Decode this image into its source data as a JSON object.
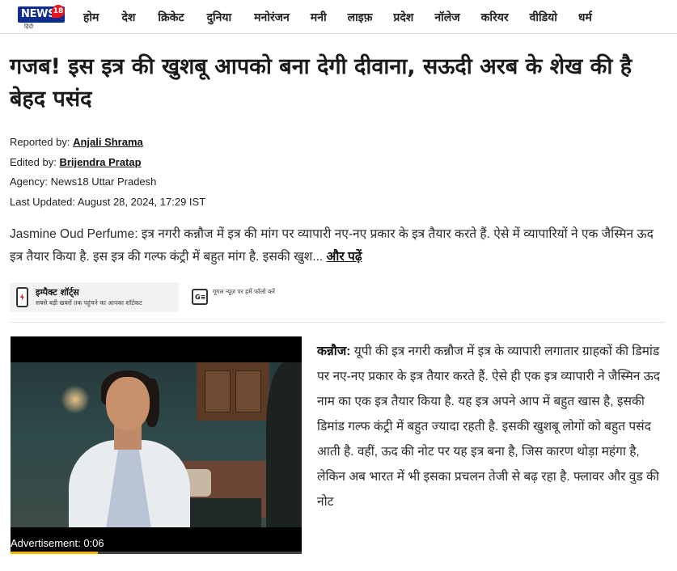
{
  "logo": {
    "brand": "NEWS",
    "number": "18",
    "sub": "हिंदी"
  },
  "nav": {
    "items": [
      "होम",
      "देश",
      "क्रिकेट",
      "दुनिया",
      "मनोरंजन",
      "मनी",
      "लाइफ़",
      "प्रदेश",
      "नॉलेज",
      "करियर",
      "वीडियो",
      "धर्म"
    ]
  },
  "headline": "गजब! इस इत्र की खुशबू आपको बना देगी दीवाना, सऊदी अरब के शेख की है बेहद पसंद",
  "meta": {
    "reported_label": "Reported by:",
    "reported_value": "Anjali Shrama",
    "edited_label": "Edited by:",
    "edited_value": "Brijendra Pratap",
    "agency_label": "Agency:",
    "agency_value": "News18 Uttar Pradesh",
    "updated_label": "Last Updated:",
    "updated_value": "August 28, 2024, 17:29 IST"
  },
  "summary": {
    "text": "Jasmine Oud Perfume: इत्र नगरी कन्नौज में इत्र की मांग पर व्यापारी नए-नए प्रकार के इत्र तैयार करते हैं. ऐसे में व्यापारियों ने एक जैस्मिन ऊद इत्र तैयार किया है. इस इत्र की गल्फ कंट्री में बहुत मांग है. इसकी खुश...",
    "read_more": "और पढ़ें"
  },
  "impact": {
    "title": "इम्पैक्ट शॉर्ट्स",
    "subtitle": "सबसे बड़ी खबरों तक पहुंचने का आपका शॉर्टकट"
  },
  "google_news": {
    "text": "गूगल न्यूज़ पर हमें फॉलो करें"
  },
  "video": {
    "ad_label": "Advertisement: 0:06",
    "progress": 0.3
  },
  "article": {
    "dateline": "कन्नौज:",
    "text": " यूपी की इत्र नगरी कन्नौज में इत्र के व्यापारी लगातार ग्राहकों की डिमांड पर नए-नए प्रकार के इत्र तैयार करते हैं. ऐसे ही एक इत्र व्यापारी ने जैस्मिन ऊद नाम का एक इत्र तैयार किया है. यह इत्र अपने आप में बहुत खास है, इसकी डिमांड गल्फ कंट्री में बहुत ज्यादा रहती है. इसकी खुशबू लोगों को बहुत पसंद आती है. वहीं, ऊद की नोट पर यह इत्र बना है, जिस कारण थोड़ा महंगा है, लेकिन अब भारत में भी इसका प्रचलन तेजी से बढ़ रहा है. फ्लावर और वुड की नोट"
  },
  "colors": {
    "brand_blue": "#0d2c8c",
    "brand_red": "#e8141f",
    "progress_yellow": "#f5b800"
  }
}
